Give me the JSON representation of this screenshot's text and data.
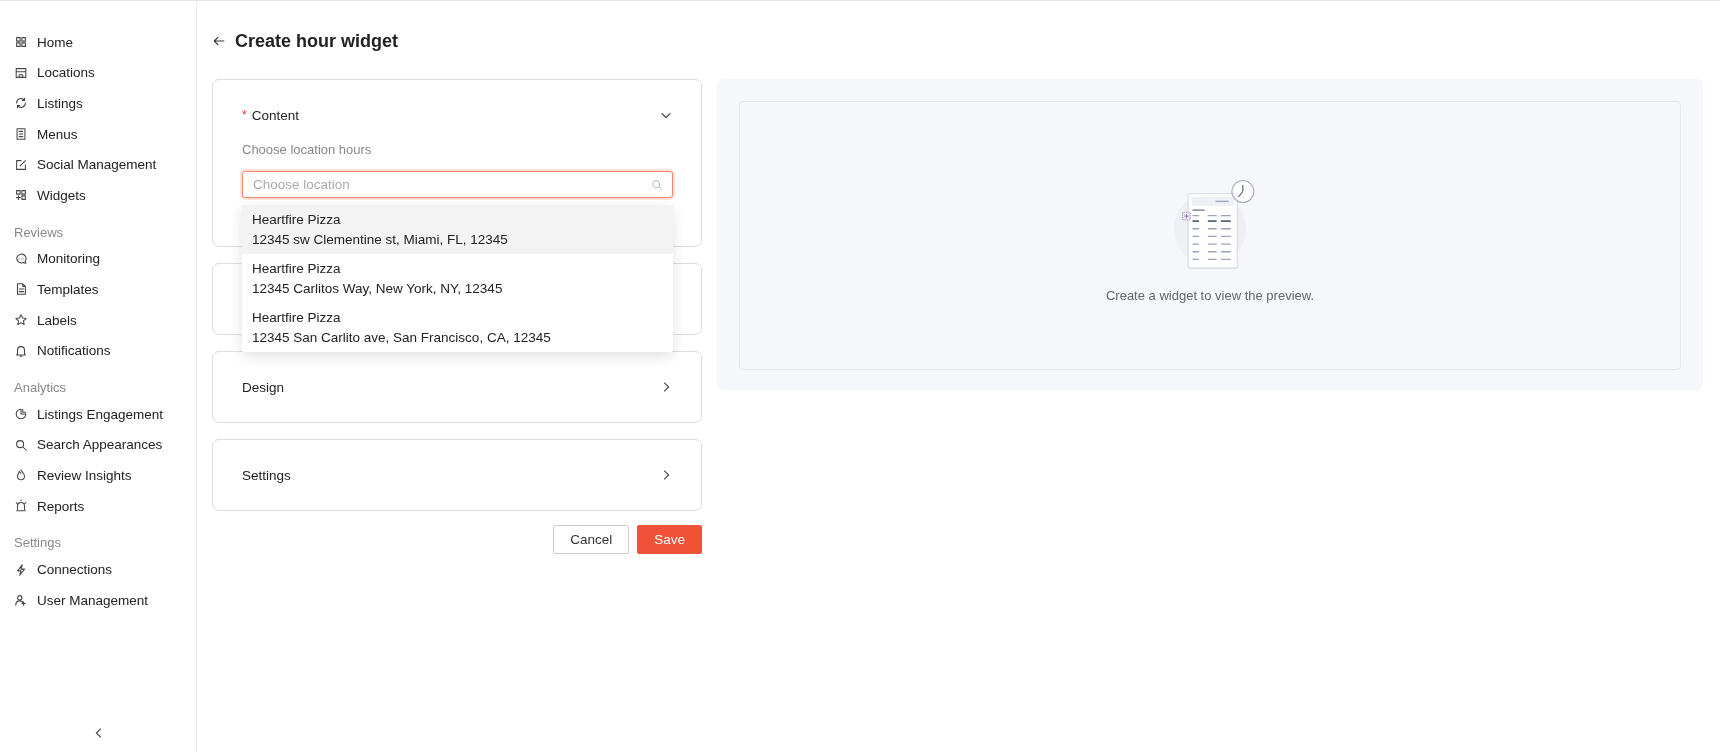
{
  "sidebar": {
    "sections": [
      {
        "items": [
          {
            "label": "Home",
            "selected": false
          },
          {
            "label": "Locations",
            "selected": false
          },
          {
            "label": "Listings",
            "selected": false
          },
          {
            "label": "Menus",
            "selected": false
          },
          {
            "label": "Social Management",
            "selected": false
          },
          {
            "label": "Widgets",
            "selected": false
          }
        ]
      },
      {
        "heading": "Reviews",
        "items": [
          {
            "label": "Monitoring",
            "selected": false
          },
          {
            "label": "Templates",
            "selected": false
          },
          {
            "label": "Labels",
            "selected": false
          },
          {
            "label": "Notifications",
            "selected": false
          }
        ]
      },
      {
        "heading": "Analytics",
        "items": [
          {
            "label": "Listings Engagement",
            "selected": false
          },
          {
            "label": "Search Appearances",
            "selected": false
          },
          {
            "label": "Review Insights",
            "selected": false
          },
          {
            "label": "Reports",
            "selected": false
          }
        ]
      },
      {
        "heading": "Settings",
        "items": [
          {
            "label": "Connections",
            "selected": false
          },
          {
            "label": "User Management",
            "selected": false
          }
        ]
      }
    ]
  },
  "page": {
    "title": "Create hour widget"
  },
  "sections": [
    {
      "title": "Content",
      "required_mark": "*",
      "expanded": true,
      "label": "Choose location hours",
      "field": {
        "placeholder": "Choose location"
      },
      "dropdown": [
        {
          "name": "Heartfire Pizza",
          "address": "12345 sw Clementine st, Miami, FL, 12345",
          "selected": true
        },
        {
          "name": "Heartfire Pizza",
          "address": "12345 Carlitos Way, New York, NY, 12345",
          "selected": false
        },
        {
          "name": "Heartfire Pizza",
          "address": "12345 San Carlito ave, San Francisco, CA, 12345",
          "selected": false
        }
      ]
    },
    {
      "expanded": false
    },
    {
      "title": "Design",
      "expanded": false
    },
    {
      "title": "Settings",
      "expanded": false
    }
  ],
  "buttons": {
    "cancel": "Cancel",
    "save": "Save"
  },
  "preview": {
    "message": "Create a widget to view the preview."
  }
}
